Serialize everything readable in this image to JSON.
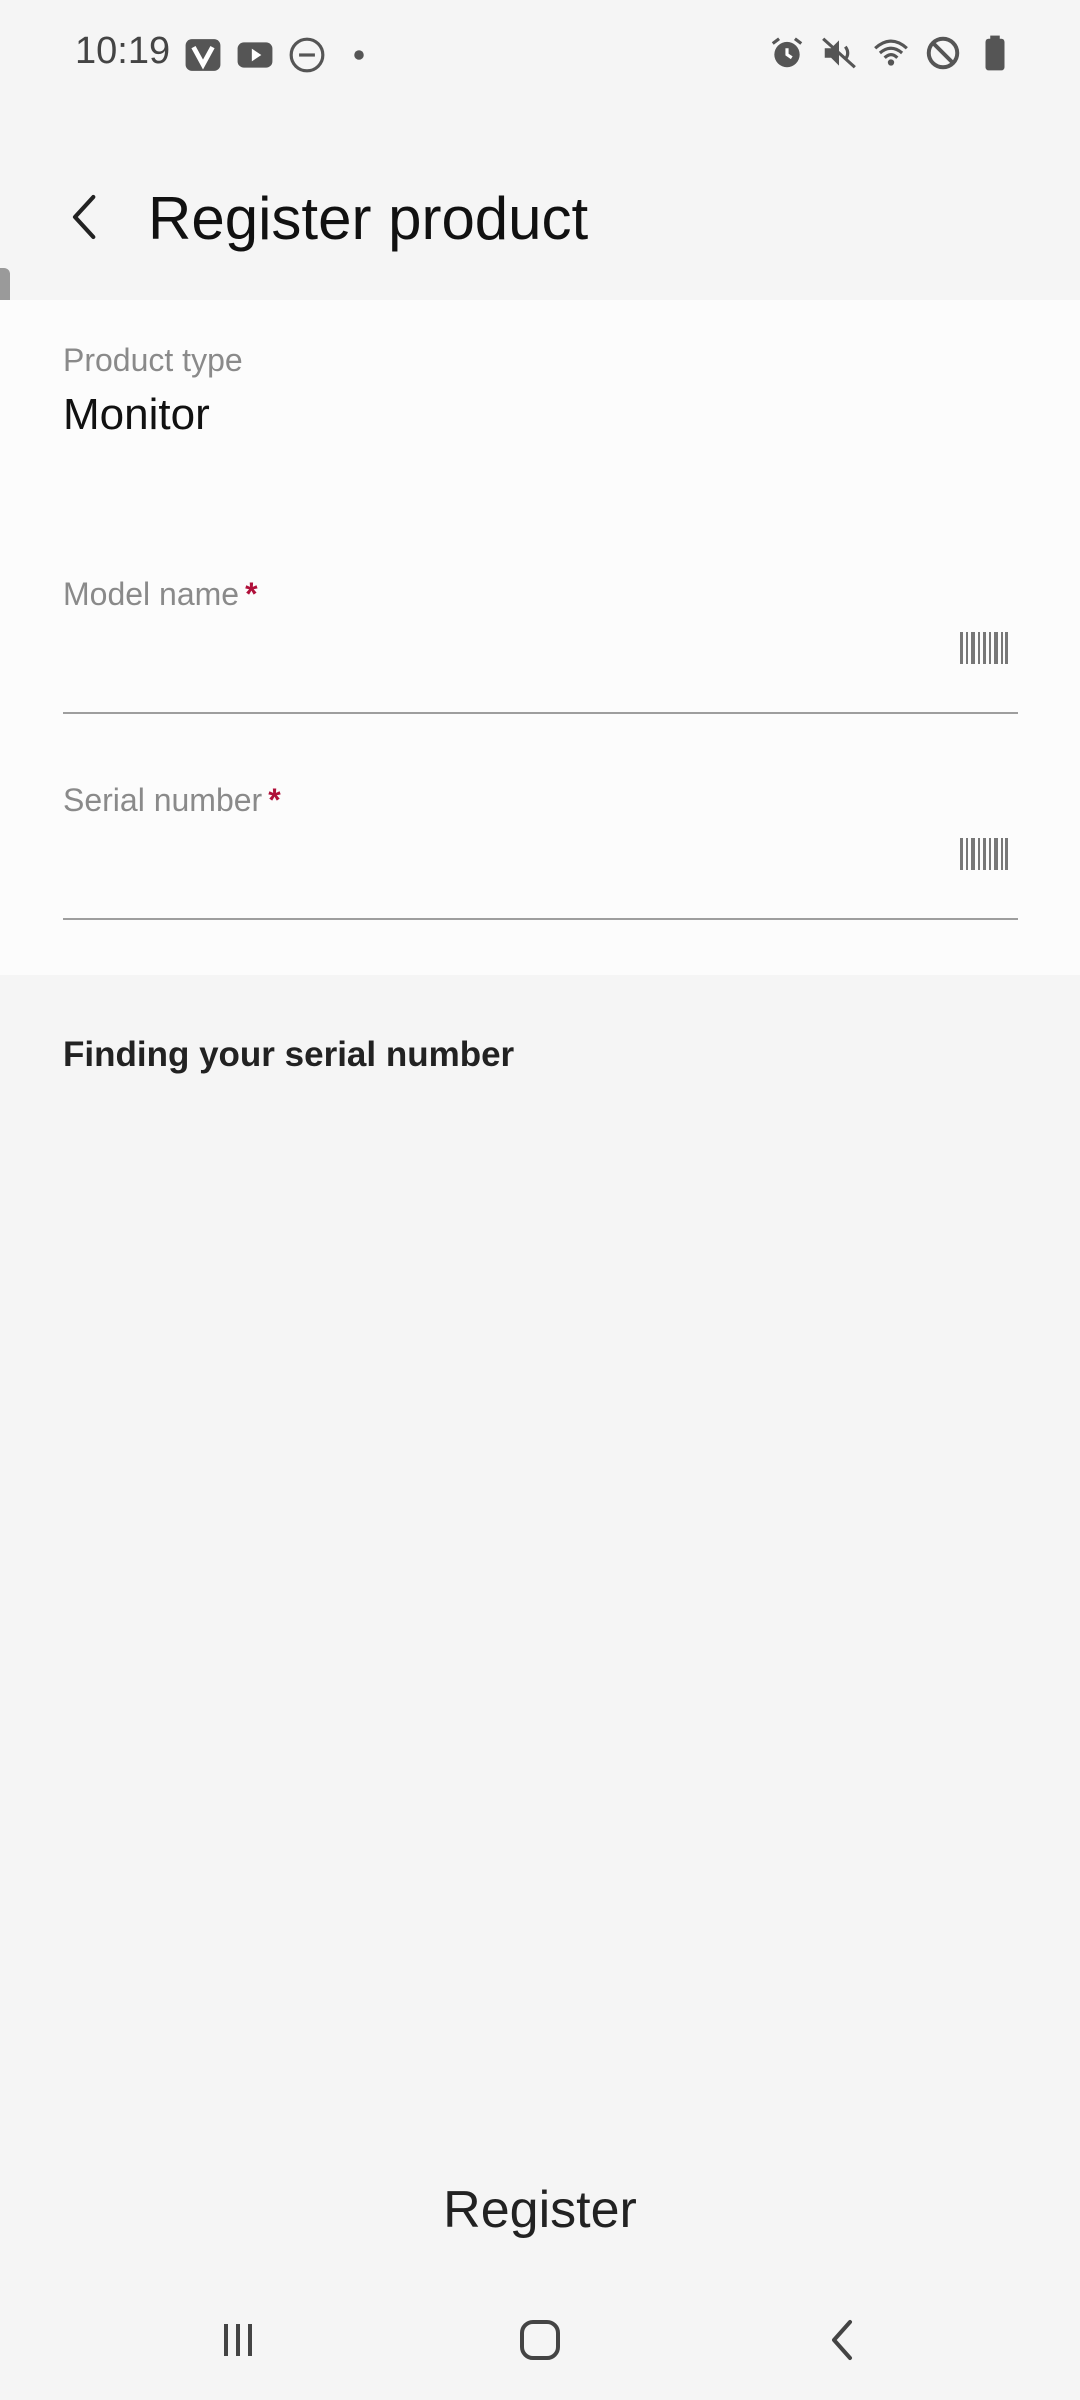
{
  "status_bar": {
    "time": "10:19",
    "left_icons": [
      "vpn-v-icon",
      "youtube-icon",
      "do-not-disturb-icon",
      "notification-dot-icon"
    ],
    "right_icons": [
      "alarm-icon",
      "mute-icon",
      "wifi-icon",
      "blocked-icon",
      "battery-icon"
    ]
  },
  "header": {
    "title": "Register product"
  },
  "form": {
    "product_type_label": "Product type",
    "product_type_value": "Monitor",
    "model_name_label": "Model name",
    "model_name_value": "",
    "serial_number_label": "Serial number",
    "serial_number_value": "",
    "required_marker": "*"
  },
  "links": {
    "finding_serial": "Finding your serial number"
  },
  "actions": {
    "register_label": "Register"
  },
  "colors": {
    "required": "#b0103a",
    "background": "#f5f5f5",
    "card": "#fcfcfc"
  }
}
